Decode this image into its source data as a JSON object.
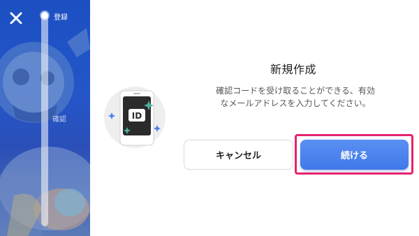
{
  "left_panel": {
    "progress_steps": [
      "登録",
      "確認"
    ],
    "close_icon": "close-icon"
  },
  "dialog": {
    "icon_label": "ID",
    "title": "新規作成",
    "description": "確認コードを受け取ることができる、有効なメールアドレスを入力してください。",
    "cancel_label": "キャンセル",
    "continue_label": "続ける"
  },
  "colors": {
    "accent_blue": "#4a82ee",
    "highlight_pink": "#e6226e",
    "panel_blue": "#2456c9"
  }
}
